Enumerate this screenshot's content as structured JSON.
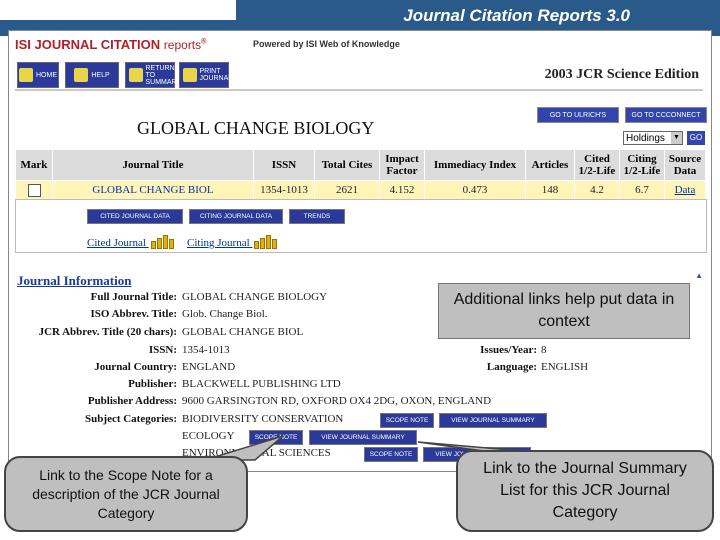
{
  "slide": {
    "title": "Journal Citation Reports 3.0"
  },
  "header": {
    "logo_main": "ISI JOURNAL CITATION",
    "logo_reports": "reports",
    "powered_by": "Powered by ISI Web of Knowledge",
    "edition": "2003 JCR Science Edition"
  },
  "nav": [
    {
      "label": "HOME",
      "icon": "home-icon"
    },
    {
      "label": "HELP",
      "icon": "help-icon"
    },
    {
      "label": "RETURN TO SUMMARY",
      "icon": "return-icon"
    },
    {
      "label": "PRINT JOURNAL",
      "icon": "print-icon"
    }
  ],
  "goto": {
    "ulrichs": "GO TO ULRICH'S",
    "ccc": "GO TO CCCONNECT"
  },
  "journal_title": "GLOBAL CHANGE BIOLOGY",
  "holdings": {
    "selected": "Holdings",
    "go": "GO"
  },
  "table": {
    "headers": [
      "Mark",
      "Journal Title",
      "ISSN",
      "Total Cites",
      "Impact Factor",
      "Immediacy Index",
      "Articles",
      "Cited 1/2-Life",
      "Citing 1/2-Life",
      "Source Data"
    ],
    "row": [
      "",
      "GLOBAL CHANGE BIOL",
      "1354-1013",
      "2621",
      "4.152",
      "0.473",
      "148",
      "4.2",
      "6.7",
      "Data"
    ]
  },
  "row_buttons": {
    "cited": "CITED JOURNAL DATA",
    "citing": "CITING JOURNAL DATA",
    "trends": "TRENDS"
  },
  "graph_links": {
    "cited": "Cited Journal",
    "citing": "Citing Journal"
  },
  "info": {
    "heading": "Journal Information",
    "fields": [
      {
        "label": "Full Journal Title:",
        "value": "GLOBAL CHANGE BIOLOGY"
      },
      {
        "label": "ISO Abbrev. Title:",
        "value": "Glob. Change Biol."
      },
      {
        "label": "JCR Abbrev. Title (20 chars):",
        "value": "GLOBAL CHANGE BIOL"
      },
      {
        "label": "ISSN:",
        "value": "1354-1013"
      },
      {
        "label": "Journal Country:",
        "value": "ENGLAND"
      },
      {
        "label": "Publisher:",
        "value": "BLACKWELL PUBLISHING LTD"
      },
      {
        "label": "Publisher Address:",
        "value": "9600 GARSINGTON RD, OXFORD OX4 2DG, OXON, ENGLAND"
      },
      {
        "label": "Subject Categories:",
        "value": "BIODIVERSITY CONSERVATION"
      }
    ],
    "issues": {
      "label": "Issues/Year:",
      "value": "8"
    },
    "language": {
      "label": "Language:",
      "value": "ENGLISH"
    },
    "categories": [
      "BIODIVERSITY CONSERVATION",
      "ECOLOGY",
      "ENVIRONMENTAL SCIENCES"
    ],
    "scope_btn": "SCOPE NOTE",
    "summary_btn": "VIEW JOURNAL SUMMARY"
  },
  "callouts": {
    "additional": "Additional links help put data in context",
    "scope": "Link to the Scope Note for a description of the JCR Journal Category",
    "summary": "Link to the Journal Summary List for this JCR Journal Category"
  }
}
